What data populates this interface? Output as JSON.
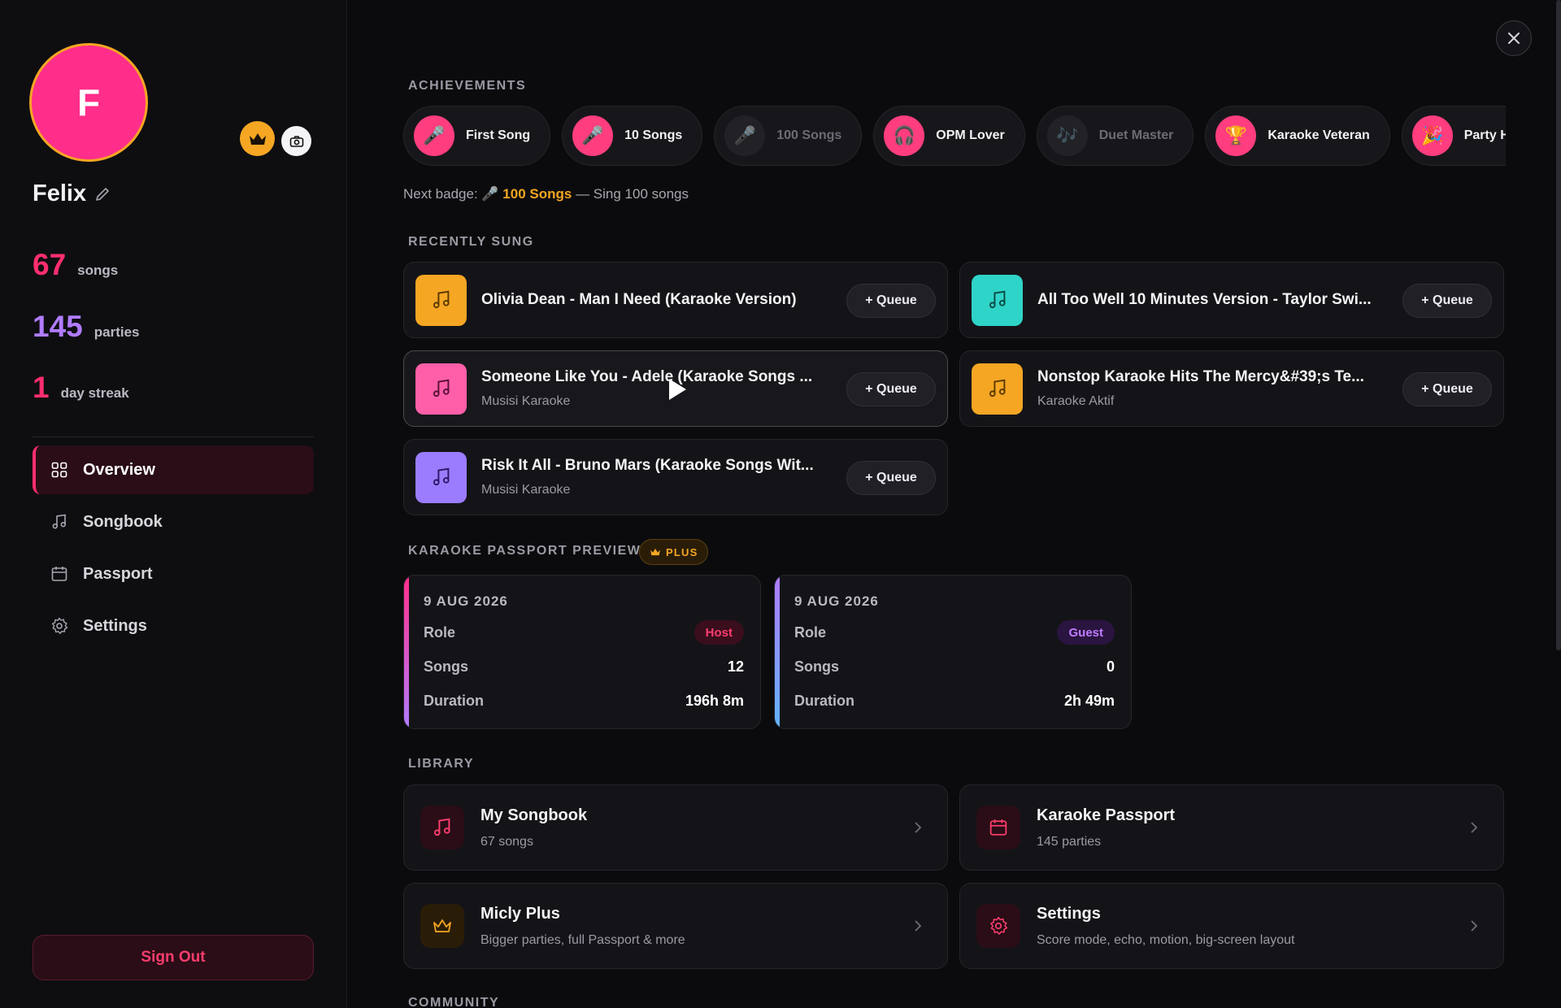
{
  "profile": {
    "initial": "F",
    "name": "Felix",
    "stats": [
      {
        "value": "67",
        "label": "songs",
        "color": "#ff2e6e"
      },
      {
        "value": "145",
        "label": "parties",
        "color": "#b07cff"
      },
      {
        "value": "1",
        "label": "day streak",
        "color": "#ff2e6e"
      }
    ]
  },
  "nav": {
    "items": [
      {
        "label": "Overview",
        "icon": "grid-icon",
        "active": true
      },
      {
        "label": "Songbook",
        "icon": "music-note-icon",
        "active": false
      },
      {
        "label": "Passport",
        "icon": "calendar-icon",
        "active": false
      },
      {
        "label": "Settings",
        "icon": "gear-icon",
        "active": false
      }
    ],
    "sign_out": "Sign Out"
  },
  "sections": {
    "achievements": "ACHIEVEMENTS",
    "recently_sung": "RECENTLY SUNG",
    "passport_preview": "KARAOKE PASSPORT PREVIEW",
    "plus_badge": "PLUS",
    "library": "LIBRARY",
    "community": "COMMUNITY"
  },
  "achievements": [
    {
      "name": "First Song",
      "icon": "🎤",
      "locked": false
    },
    {
      "name": "10 Songs",
      "icon": "🎤",
      "locked": false
    },
    {
      "name": "100 Songs",
      "icon": "🎤",
      "locked": true
    },
    {
      "name": "OPM Lover",
      "icon": "🎧",
      "locked": false
    },
    {
      "name": "Duet Master",
      "icon": "🎶",
      "locked": true
    },
    {
      "name": "Karaoke Veteran",
      "icon": "🏆",
      "locked": false
    },
    {
      "name": "Party Host",
      "icon": "🎉",
      "locked": false
    }
  ],
  "next_badge": {
    "prefix": "Next badge: 🎤 ",
    "name": "100 Songs",
    "suffix": " — Sing 100 songs"
  },
  "recently_sung": [
    {
      "title": "Olivia Dean - Man I Need (Karaoke Version)",
      "artist": "",
      "color": "#f5a623",
      "queue": "+ Queue"
    },
    {
      "title": "All Too Well 10 Minutes Version - Taylor Swi...",
      "artist": "",
      "color": "#2fd4c8",
      "queue": "+ Queue"
    },
    {
      "title": "Someone Like You - Adele (Karaoke Songs ...",
      "artist": "Musisi Karaoke",
      "color": "#ff5fa8",
      "queue": "+ Queue"
    },
    {
      "title": "Nonstop Karaoke Hits The Mercy&#39;s Te...",
      "artist": "Karaoke Aktif",
      "color": "#f5a623",
      "queue": "+ Queue"
    },
    {
      "title": "Risk It All - Bruno Mars (Karaoke Songs Wit...",
      "artist": "Musisi Karaoke",
      "color": "#9b7cff",
      "queue": "+ Queue"
    }
  ],
  "passport": [
    {
      "date": "9 AUG 2026",
      "role_label": "Role",
      "role": "Host",
      "songs_label": "Songs",
      "songs": "12",
      "duration_label": "Duration",
      "duration": "196h 8m"
    },
    {
      "date": "9 AUG 2026",
      "role_label": "Role",
      "role": "Guest",
      "songs_label": "Songs",
      "songs": "0",
      "duration_label": "Duration",
      "duration": "2h 49m"
    }
  ],
  "library": [
    {
      "title": "My Songbook",
      "subtitle": "67 songs",
      "icon": "music-note-icon"
    },
    {
      "title": "Karaoke Passport",
      "subtitle": "145 parties",
      "icon": "calendar-icon"
    },
    {
      "title": "Micly Plus",
      "subtitle": "Bigger parties, full Passport & more",
      "icon": "crown-icon"
    },
    {
      "title": "Settings",
      "subtitle": "Score mode, echo, motion, big-screen layout",
      "icon": "gear-icon"
    }
  ]
}
